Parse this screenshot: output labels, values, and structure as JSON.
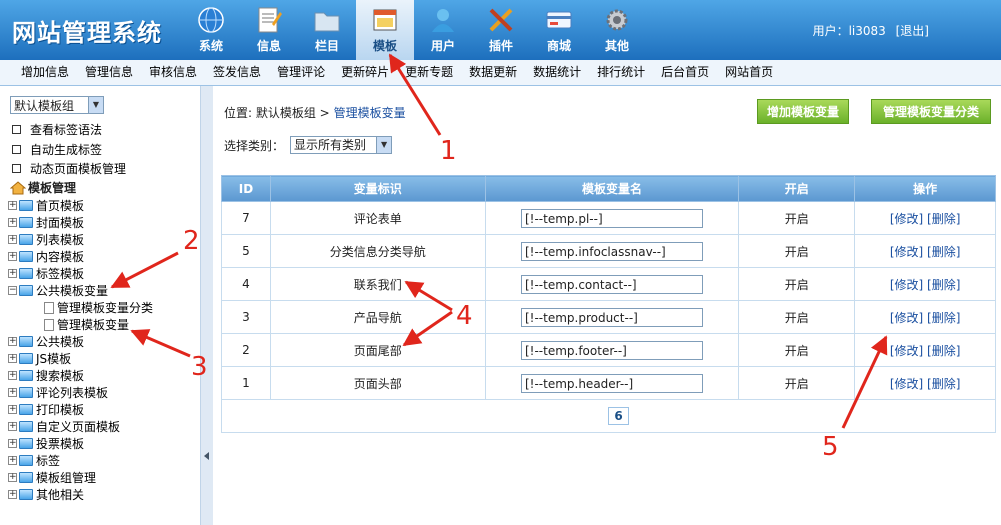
{
  "header": {
    "title": "网站管理系统",
    "nav": [
      {
        "label": "系统",
        "icon": "globe-icon"
      },
      {
        "label": "信息",
        "icon": "document-icon"
      },
      {
        "label": "栏目",
        "icon": "folder-icon"
      },
      {
        "label": "模板",
        "icon": "template-window-icon",
        "active": true
      },
      {
        "label": "用户",
        "icon": "user-icon"
      },
      {
        "label": "插件",
        "icon": "tools-icon"
      },
      {
        "label": "商城",
        "icon": "card-icon"
      },
      {
        "label": "其他",
        "icon": "gear-icon"
      }
    ],
    "user_label": "用户：li3083",
    "logout": "[退出]"
  },
  "subnav": [
    "增加信息",
    "管理信息",
    "审核信息",
    "签发信息",
    "管理评论",
    "更新碎片",
    "更新专题",
    "数据更新",
    "数据统计",
    "排行统计",
    "后台首页",
    "网站首页"
  ],
  "left": {
    "template_group_select": "默认模板组",
    "links": [
      "查看标签语法",
      "自动生成标签",
      "动态页面模板管理"
    ],
    "tree_root": "模板管理",
    "tree": [
      {
        "label": "首页模板"
      },
      {
        "label": "封面模板"
      },
      {
        "label": "列表模板"
      },
      {
        "label": "内容模板"
      },
      {
        "label": "标签模板"
      },
      {
        "label": "公共模板变量",
        "open": true,
        "children": [
          "管理模板变量分类",
          "管理模板变量"
        ]
      },
      {
        "label": "公共模板"
      },
      {
        "label": "JS模板"
      },
      {
        "label": "搜索模板"
      },
      {
        "label": "评论列表模板"
      },
      {
        "label": "打印模板"
      },
      {
        "label": "自定义页面模板"
      },
      {
        "label": "投票模板"
      },
      {
        "label": "标签"
      },
      {
        "label": "模板组管理"
      },
      {
        "label": "其他相关"
      }
    ]
  },
  "main": {
    "breadcrumb_prefix": "位置: 默认模板组 >",
    "breadcrumb_link": "管理模板变量",
    "add_button": "增加模板变量",
    "manage_category_button": "管理模板变量分类",
    "filter_label": "选择类别：",
    "filter_value": "显示所有类别",
    "columns": [
      "ID",
      "变量标识",
      "模板变量名",
      "开启",
      "操作"
    ],
    "rows": [
      {
        "id": "7",
        "name": "评论表单",
        "var": "[!--temp.pl--]",
        "enabled": "开启"
      },
      {
        "id": "5",
        "name": "分类信息分类导航",
        "var": "[!--temp.infoclassnav--]",
        "enabled": "开启"
      },
      {
        "id": "4",
        "name": "联系我们",
        "var": "[!--temp.contact--]",
        "enabled": "开启"
      },
      {
        "id": "3",
        "name": "产品导航",
        "var": "[!--temp.product--]",
        "enabled": "开启"
      },
      {
        "id": "2",
        "name": "页面尾部",
        "var": "[!--temp.footer--]",
        "enabled": "开启"
      },
      {
        "id": "1",
        "name": "页面头部",
        "var": "[!--temp.header--]",
        "enabled": "开启"
      }
    ],
    "edit_label": "[修改]",
    "delete_label": "[删除]",
    "page_count": "6"
  },
  "annotations": [
    "1",
    "2",
    "3",
    "4",
    "5"
  ],
  "colors": {
    "header_top": "#4fa6e6",
    "header_bottom": "#1d6fbd",
    "button_green": "#6bb12a",
    "annotation_red": "#e0261c"
  }
}
